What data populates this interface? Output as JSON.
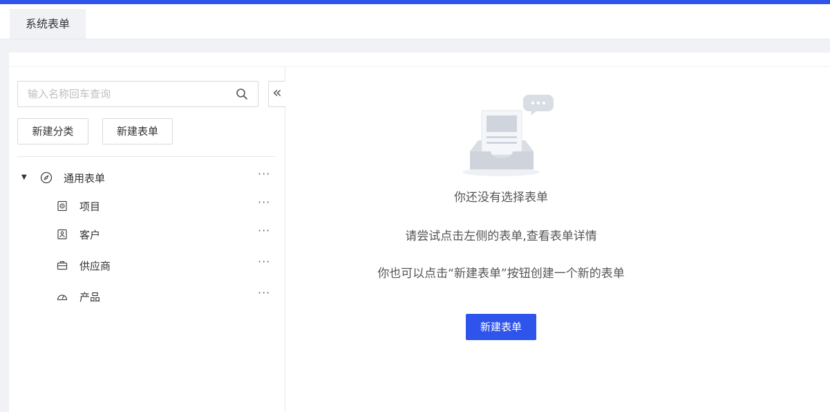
{
  "tabs": [
    {
      "label": "系统表单"
    }
  ],
  "search": {
    "placeholder": "输入名称回车查询",
    "value": ""
  },
  "toolbar": {
    "new_category_label": "新建分类",
    "new_form_label": "新建表单"
  },
  "collapse": {
    "glyph": "«"
  },
  "tree": {
    "group": {
      "label": "通用表单",
      "icon": "compass-icon",
      "expanded": true
    },
    "items": [
      {
        "label": "项目",
        "icon": "target-icon"
      },
      {
        "label": "客户",
        "icon": "person-card-icon"
      },
      {
        "label": "供应商",
        "icon": "briefcase-icon"
      },
      {
        "label": "产品",
        "icon": "speedometer-icon"
      }
    ],
    "more_glyph": "···"
  },
  "empty_state": {
    "title": "你还没有选择表单",
    "hint1": "请尝试点击左侧的表单,查看表单详情",
    "hint2": "你也可以点击“新建表单”按钮创建一个新的表单",
    "button_label": "新建表单"
  },
  "colors": {
    "accent": "#2f54eb",
    "background": "#f0f2f5"
  }
}
